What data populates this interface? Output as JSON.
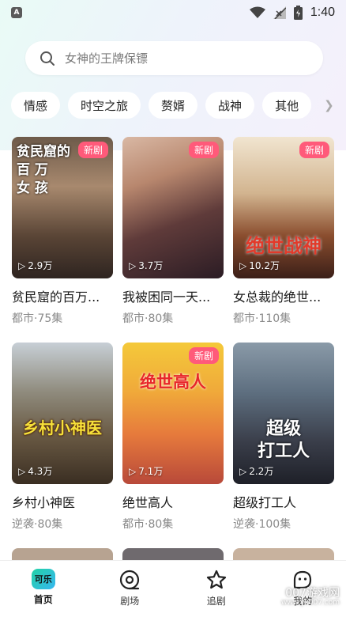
{
  "status": {
    "time": "1:40",
    "app_glyph": "A"
  },
  "search": {
    "placeholder": "女神的王牌保镖"
  },
  "categories": [
    "情感",
    "时空之旅",
    "赘婿",
    "战神",
    "其他"
  ],
  "cards": [
    {
      "title": "贫民窟的百万...",
      "meta": "都市·75集",
      "plays": "2.9万",
      "badge": "新剧",
      "art": "贫民窟的\n百 万\n女 孩"
    },
    {
      "title": "我被困同一天...",
      "meta": "都市·80集",
      "plays": "3.7万",
      "badge": "新剧",
      "art": ""
    },
    {
      "title": "女总裁的绝世...",
      "meta": "都市·110集",
      "plays": "10.2万",
      "badge": "新剧",
      "art": "绝世战神"
    },
    {
      "title": "乡村小神医",
      "meta": "逆袭·80集",
      "plays": "4.3万",
      "badge": "",
      "art": "乡村小神医"
    },
    {
      "title": "绝世高人",
      "meta": "都市·80集",
      "plays": "7.1万",
      "badge": "新剧",
      "art": "绝世高人"
    },
    {
      "title": "超级打工人",
      "meta": "逆袭·100集",
      "plays": "2.2万",
      "badge": "",
      "art": "超级\n打工人"
    }
  ],
  "tabbar": {
    "home": {
      "label": "首页",
      "logo": "可乐"
    },
    "theater": {
      "label": "剧场"
    },
    "follow": {
      "label": "追剧"
    },
    "mine": {
      "label": "我的"
    }
  },
  "watermark": {
    "text": "007游戏网",
    "url": "www.yx007.com"
  },
  "colors": {
    "badge": "#ff5a7a",
    "accent": "#22d3a6"
  }
}
